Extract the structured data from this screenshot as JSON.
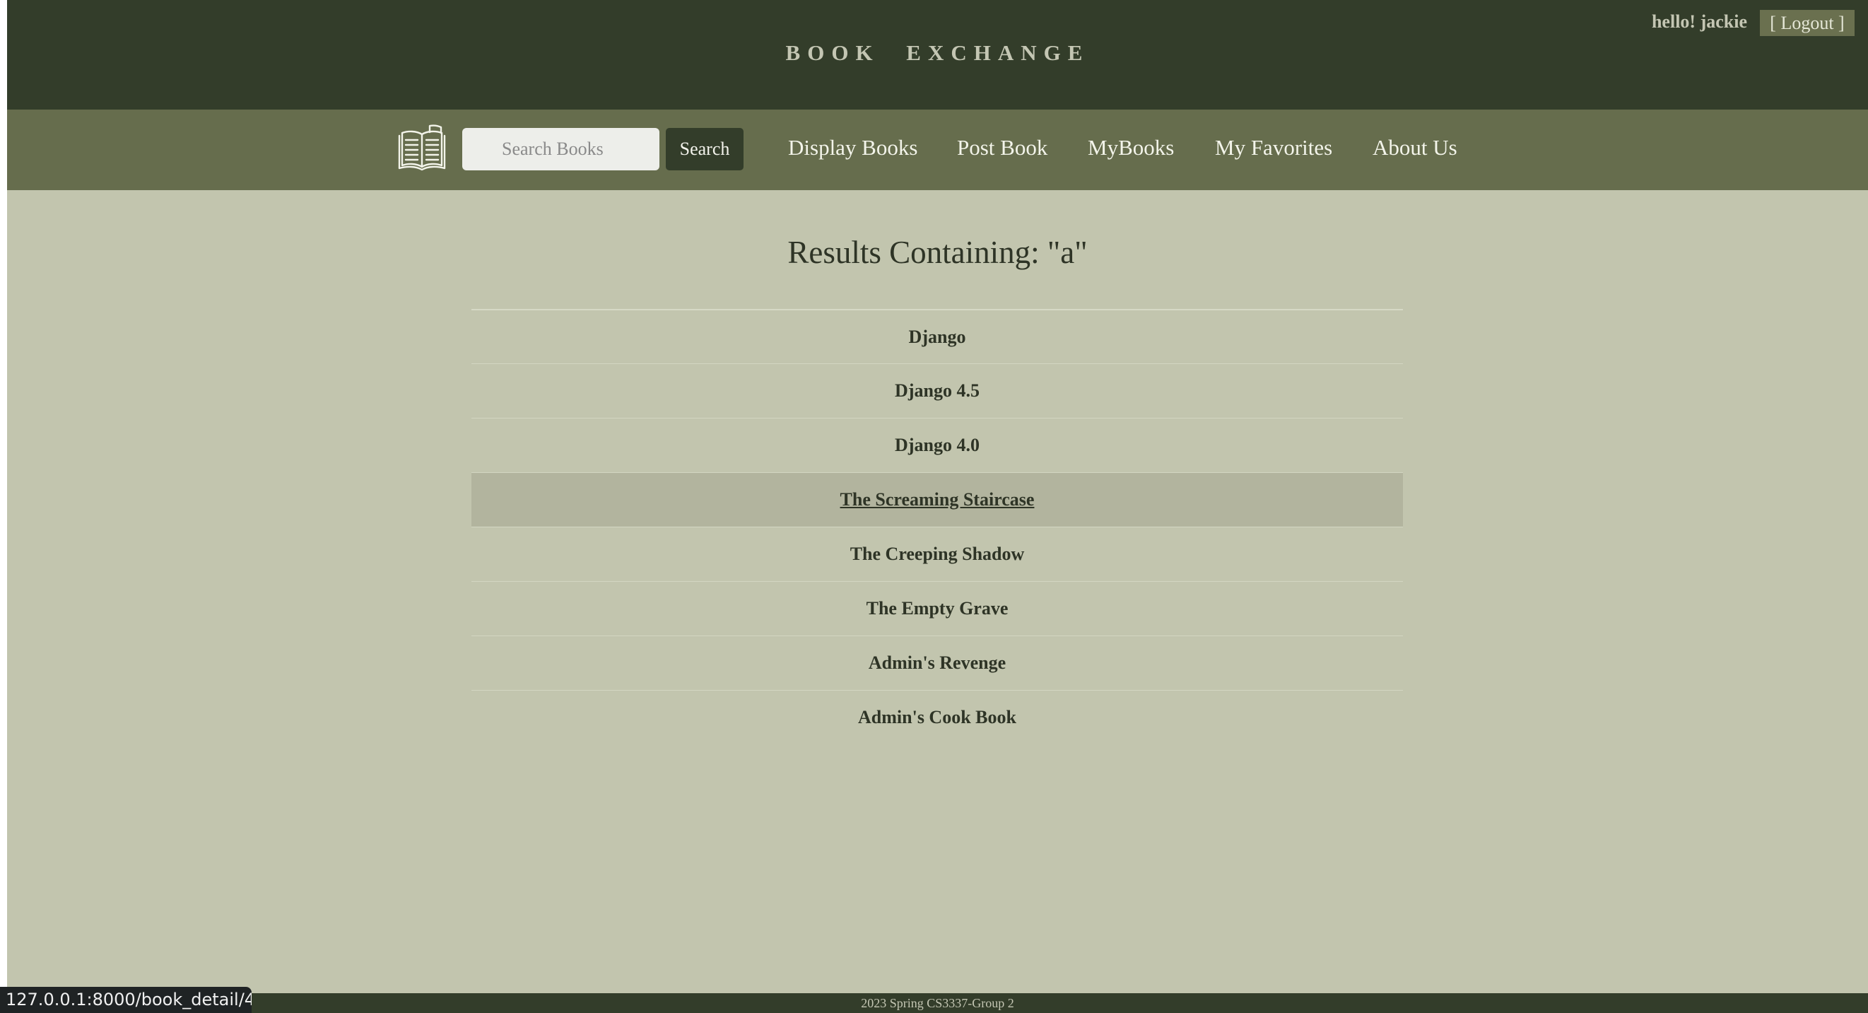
{
  "header": {
    "site_title": "BOOK EXCHANGE",
    "greeting": "hello! jackie",
    "logout_label": "[ Logout ]"
  },
  "nav": {
    "logo_icon": "open-book-icon",
    "search": {
      "placeholder": "Search Books",
      "value": "",
      "button_label": "Search"
    },
    "links": [
      {
        "label": "Display Books"
      },
      {
        "label": "Post Book"
      },
      {
        "label": "MyBooks"
      },
      {
        "label": "My Favorites"
      },
      {
        "label": "About Us"
      }
    ]
  },
  "main": {
    "heading": "Results Containing: \"a\"",
    "results": [
      {
        "title": "Django"
      },
      {
        "title": "Django 4.5"
      },
      {
        "title": "Django 4.0"
      },
      {
        "title": "The Screaming Staircase",
        "hovered": true
      },
      {
        "title": "The Creeping Shadow"
      },
      {
        "title": "The Empty Grave"
      },
      {
        "title": "Admin's Revenge"
      },
      {
        "title": "Admin's Cook Book"
      }
    ]
  },
  "footer": {
    "text": "2023 Spring CS3337-Group 2"
  },
  "browser": {
    "status_url": "127.0.0.1:8000/book_detail/4"
  },
  "colors": {
    "header_bg": "#333d2a",
    "nav_bg": "#666d4d",
    "page_bg": "#c2c5ae",
    "hover_row_bg": "#b2b49e"
  }
}
